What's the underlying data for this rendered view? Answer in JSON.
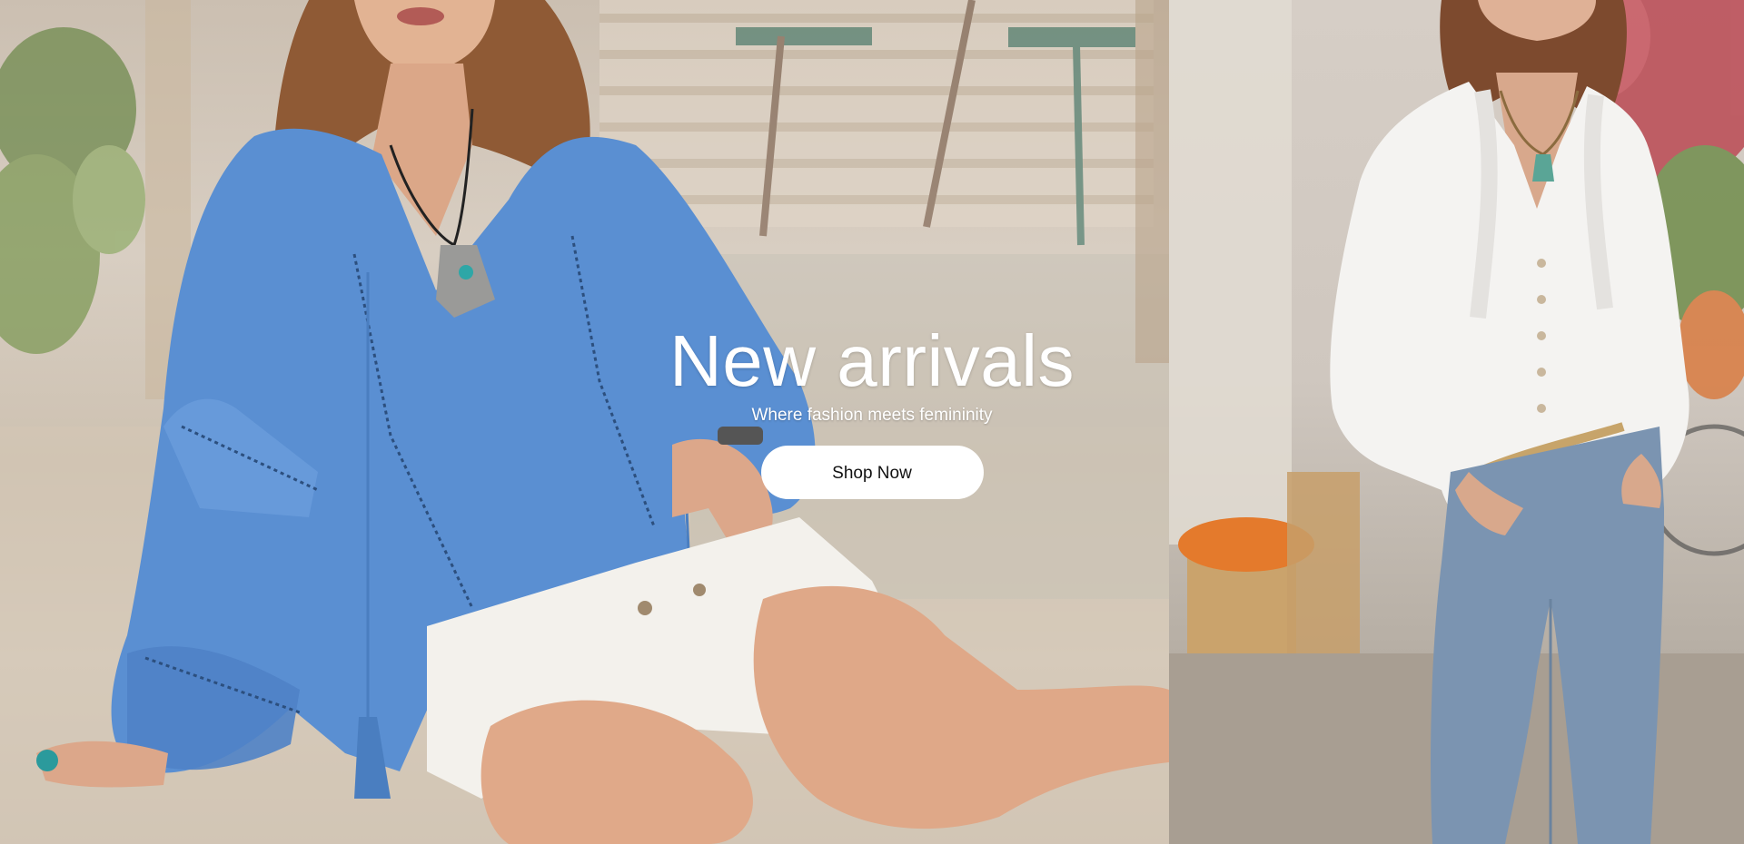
{
  "hero": {
    "title": "New arrivals",
    "subtitle": "Where fashion meets femininity",
    "cta_label": "Shop Now"
  },
  "images": {
    "left": "model-in-blue-tunic-sitting-on-sand",
    "right": "model-in-white-ruffle-blouse-and-jeans"
  },
  "colors": {
    "title_text": "#ffffff",
    "button_bg": "#ffffff",
    "button_text": "#111111",
    "blouse_blue": "#5b8fd0",
    "blouse_white": "#f4f3f1",
    "jeans_blue": "#7a93b0"
  }
}
